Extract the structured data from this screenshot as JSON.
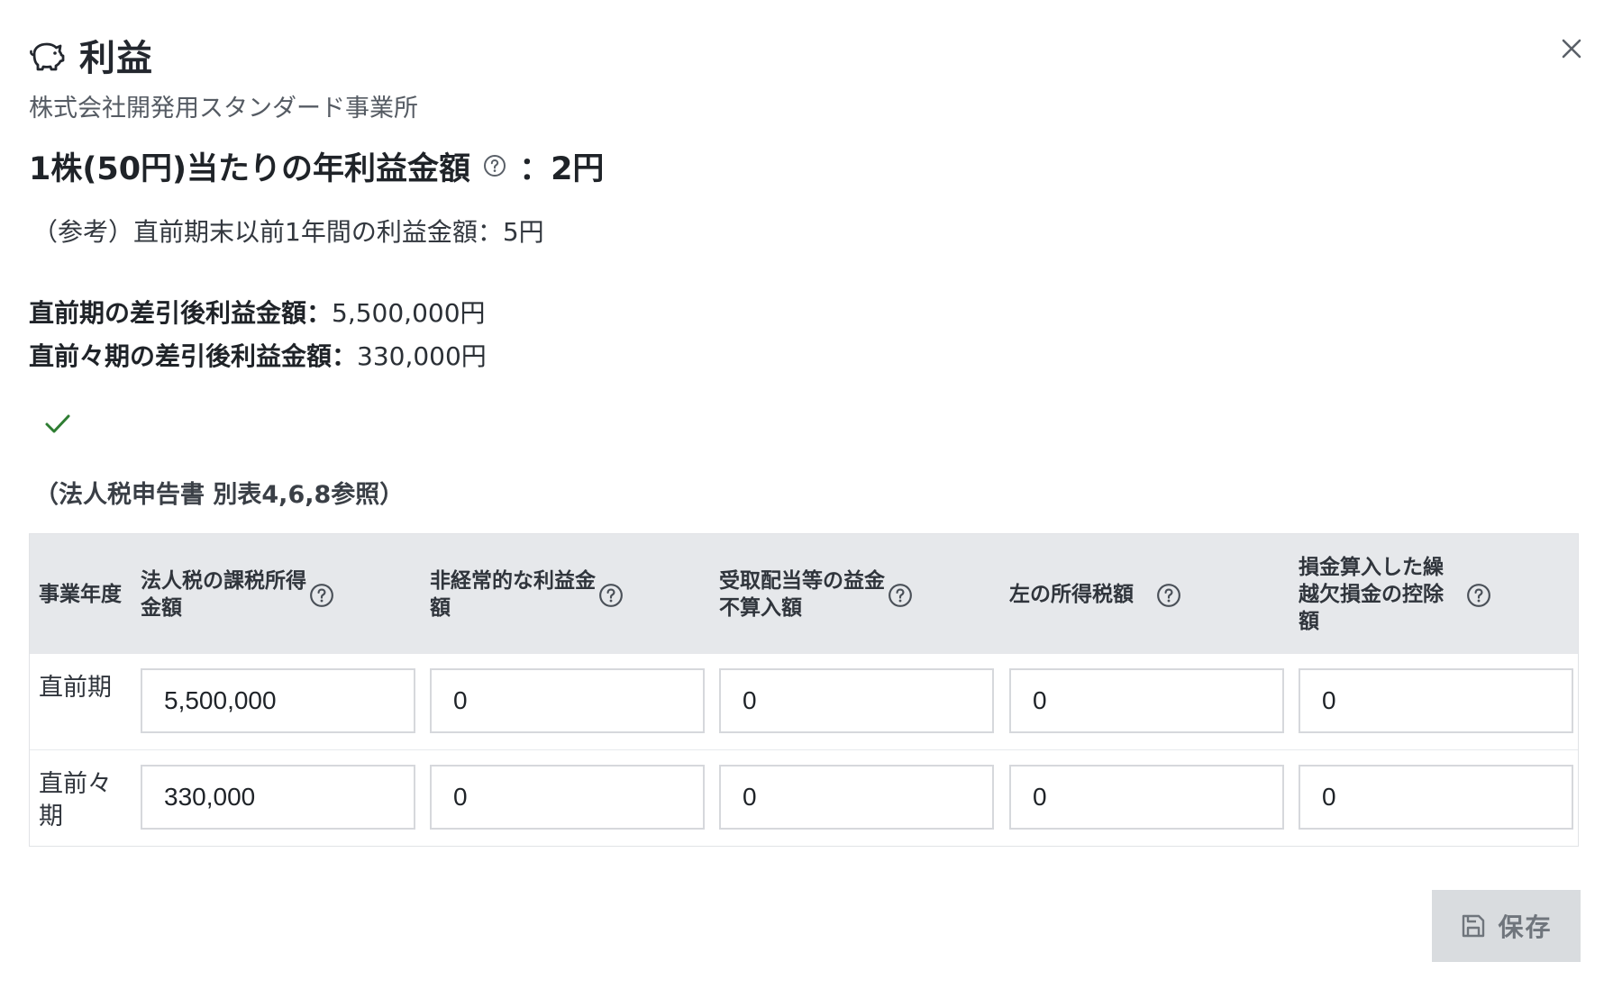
{
  "dialog": {
    "title": "利益",
    "title_icon": "piggy-bank-icon",
    "close_icon": "close-icon",
    "company_name": "株式会社開発用スタンダード事業所"
  },
  "per_share": {
    "label": "1株(50円)当たりの年利益金額",
    "value": "：2円",
    "help_icon": "help-icon"
  },
  "reference": "（参考）直前期末以前1年間の利益金額：5円",
  "profits": [
    {
      "label": "直前期の差引後利益金額：",
      "value": "5,500,000円"
    },
    {
      "label": "直前々期の差引後利益金額：",
      "value": "330,000円"
    }
  ],
  "checkbox": {
    "icon": "check-icon",
    "checked": true,
    "color": "#2e7d32"
  },
  "form_reference": "（法人税申告書 別表4,6,8参照）",
  "table": {
    "headers": [
      "事業年度",
      "法人税の課税所得金額",
      "非経常的な利益金額",
      "受取配当等の益金不算入額",
      "左の所得税額",
      "損金算入した繰越欠損金の控除額"
    ],
    "rows": [
      {
        "label": "直前期",
        "values": [
          "5,500,000",
          "0",
          "0",
          "0",
          "0"
        ]
      },
      {
        "label": "直前々期",
        "values": [
          "330,000",
          "0",
          "0",
          "0",
          "0"
        ]
      }
    ]
  },
  "save_button": {
    "label": "保存",
    "icon": "save-icon"
  },
  "colors": {
    "header_bg": "#e6e8eb",
    "button_disabled_bg": "#d9dcdf",
    "text": "#1f2328"
  }
}
